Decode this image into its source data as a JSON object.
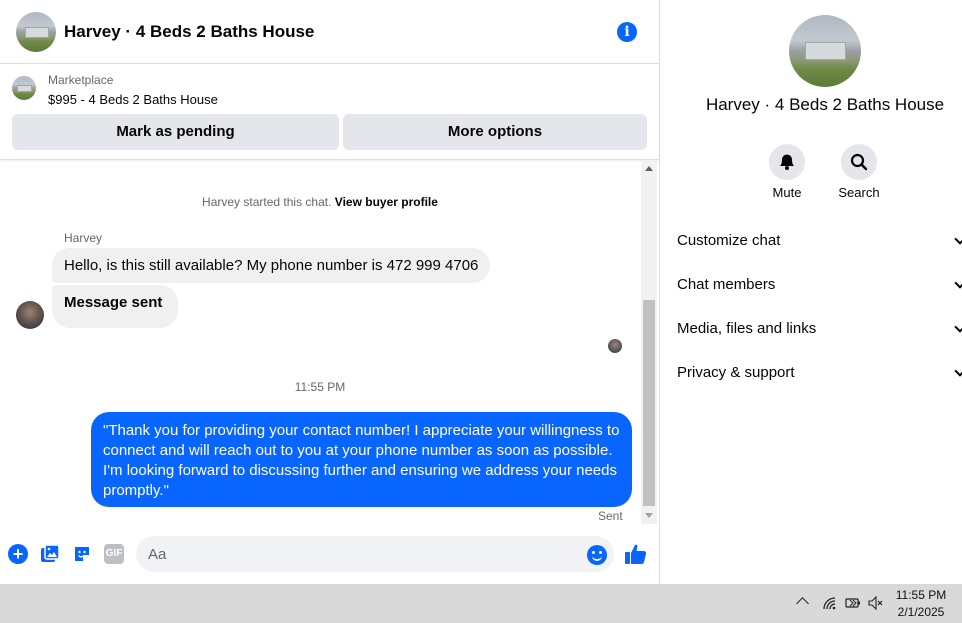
{
  "header": {
    "title": "Harvey · 4 Beds 2 Baths House",
    "info_icon": "info-icon"
  },
  "marketplace": {
    "label": "Marketplace",
    "item": "$995 - 4 Beds 2 Baths House",
    "buttons": {
      "mark_pending": "Mark as pending",
      "more_options": "More options"
    }
  },
  "conversation": {
    "started_prefix": "Harvey started this chat.",
    "view_profile": "View buyer profile",
    "sender_name": "Harvey",
    "incoming": [
      "Hello, is this still available? My phone number is 472 999 4706",
      "Message sent"
    ],
    "timestamp": "11:55 PM",
    "outgoing": "\"Thank you for providing your contact number! I appreciate your willingness to connect and will reach out to you at your phone number as soon as possible. I'm looking forward to discussing further and ensuring we address your needs promptly.\"",
    "status": "Sent"
  },
  "composer": {
    "placeholder": "Aa",
    "gif_label": "GIF"
  },
  "sidebar": {
    "title": "Harvey · 4 Beds 2 Baths House",
    "actions": [
      {
        "label": "Mute",
        "icon": "bell-icon"
      },
      {
        "label": "Search",
        "icon": "search-icon"
      }
    ],
    "menu": [
      "Customize chat",
      "Chat members",
      "Media, files and links",
      "Privacy & support"
    ]
  },
  "taskbar": {
    "time": "11:55 PM",
    "date": "2/1/2025"
  },
  "colors": {
    "accent": "#0866ff",
    "bubble_in": "#f0f0f0",
    "taskbar": "#d9d9d9"
  }
}
